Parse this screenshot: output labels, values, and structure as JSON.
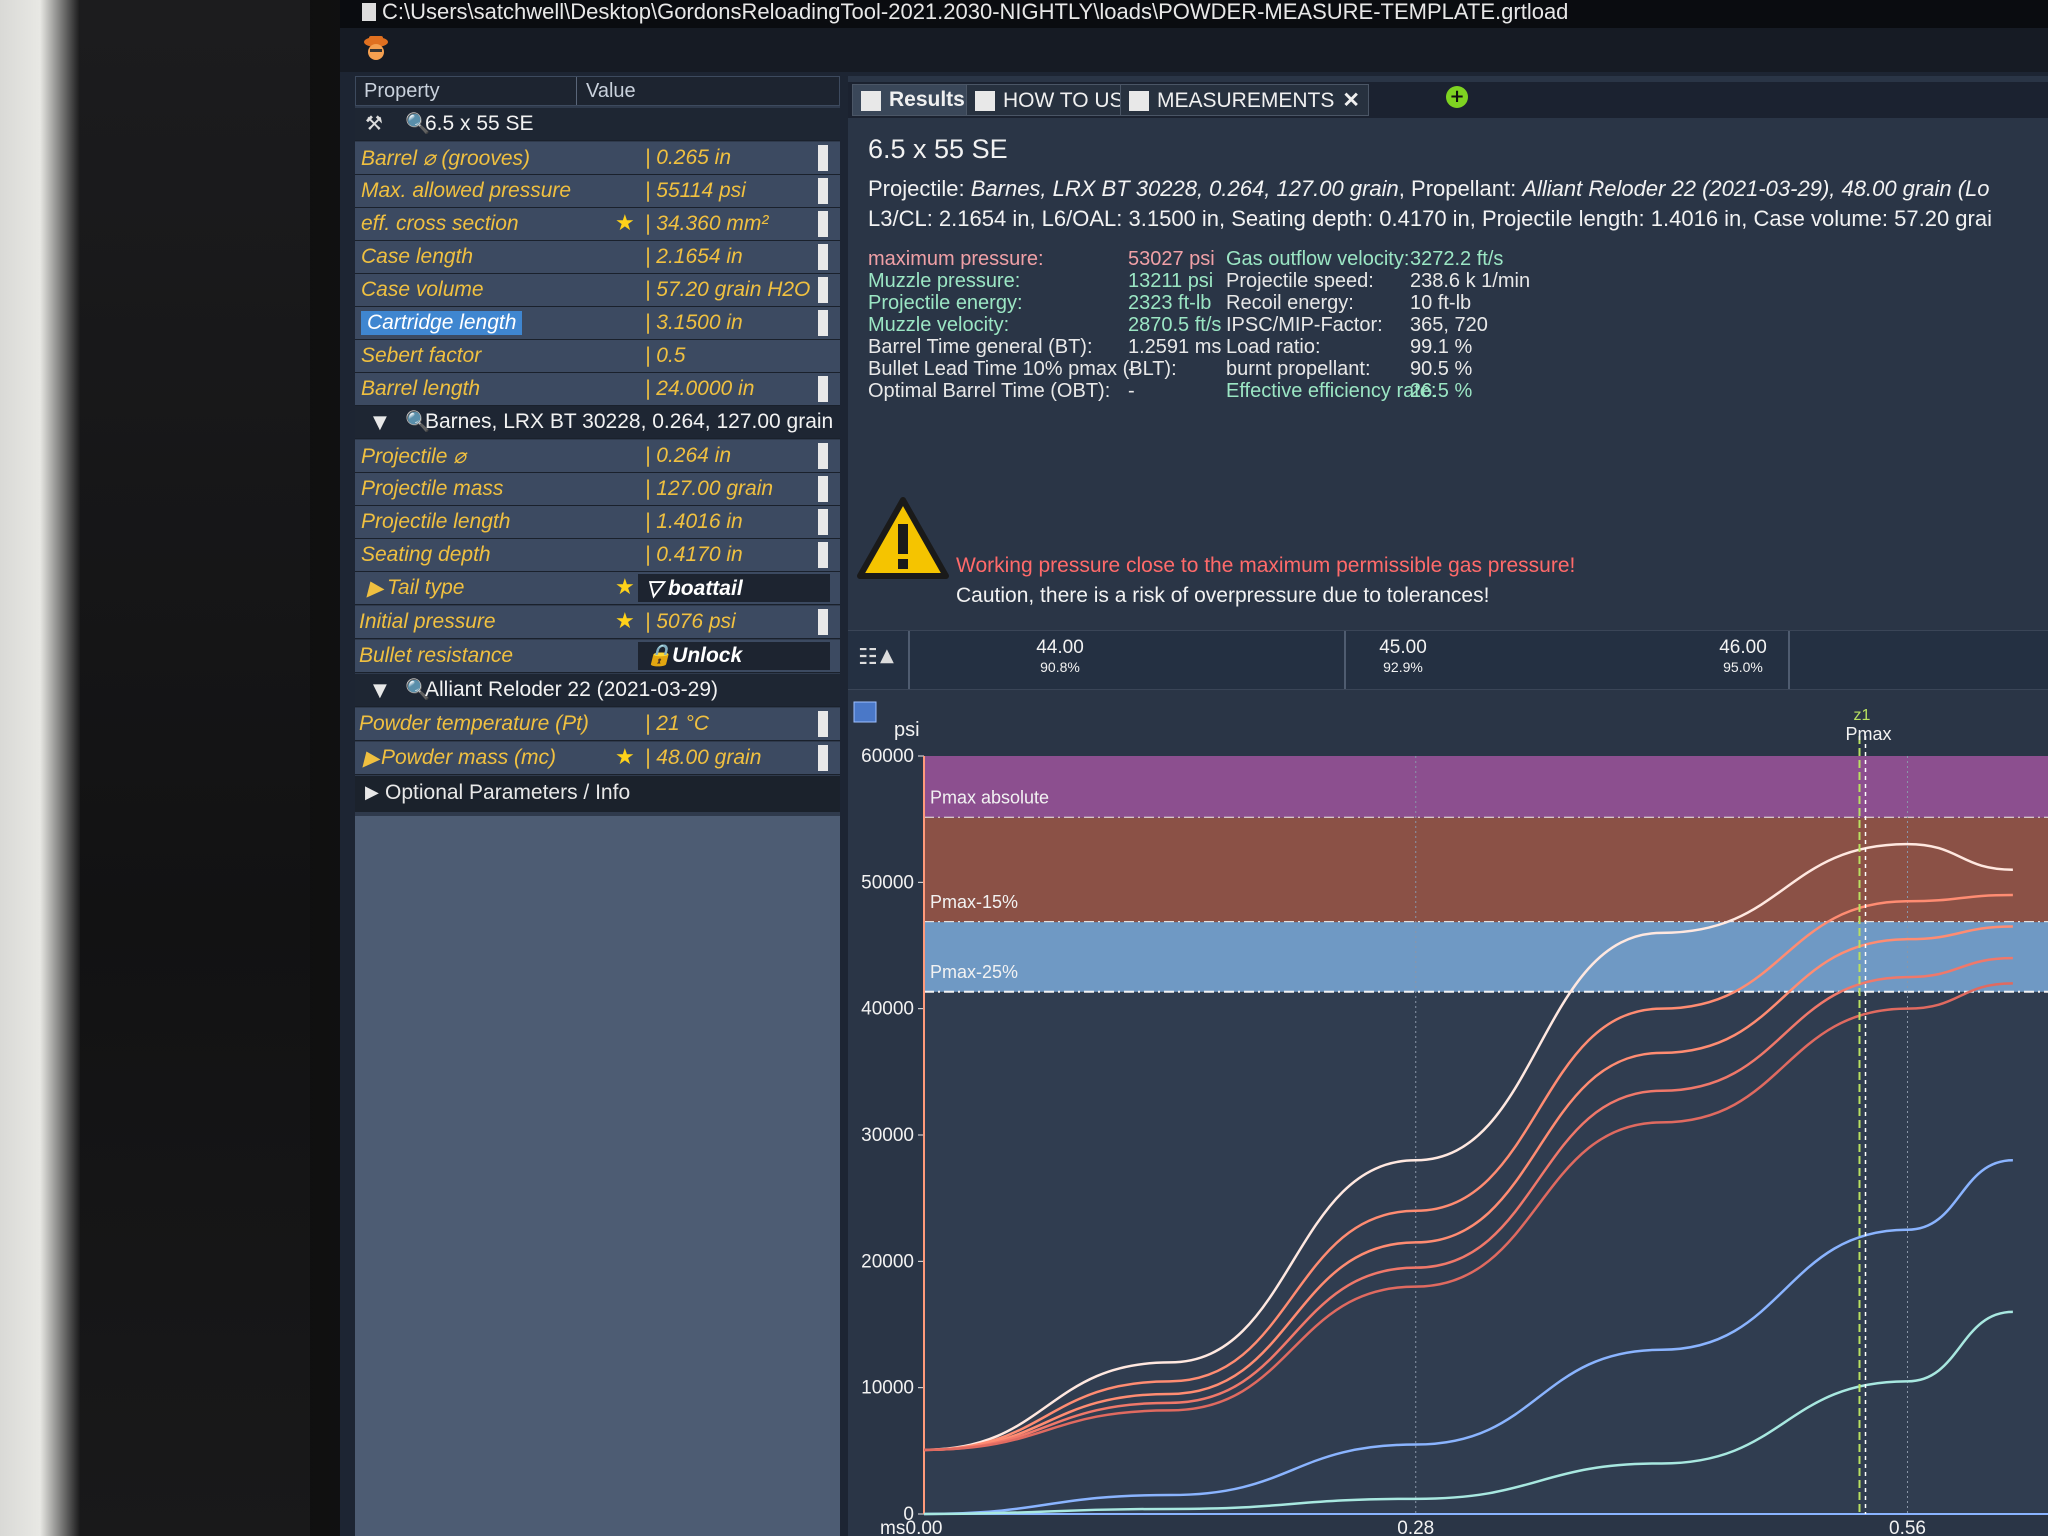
{
  "window": {
    "title": "C:\\Users\\satchwell\\Desktop\\GordonsReloadingTool-2021.2030-NIGHTLY\\loads\\POWDER-MEASURE-TEMPLATE.grtload"
  },
  "property_grid": {
    "header_property": "Property",
    "header_value": "Value",
    "cartridge_group": "6.5 x 55 SE",
    "rows_cartridge": [
      {
        "label": "Barrel ⌀ (grooves)",
        "value": "| 0.265 in",
        "star": false,
        "spin": true
      },
      {
        "label": "Max. allowed pressure",
        "value": "| 55114 psi",
        "star": false,
        "spin": true
      },
      {
        "label": "eff. cross section",
        "value": "| 34.360 mm²",
        "star": true,
        "spin": true
      },
      {
        "label": "Case length",
        "value": "| 2.1654 in",
        "star": false,
        "spin": true
      },
      {
        "label": "Case volume",
        "value": "| 57.20 grain H2O",
        "star": false,
        "spin": true
      },
      {
        "label": "Cartridge length",
        "value": "| 3.1500 in",
        "star": false,
        "spin": true,
        "selected": true
      },
      {
        "label": "Sebert factor",
        "value": "| 0.5",
        "star": false,
        "spin": false
      },
      {
        "label": "Barrel length",
        "value": "| 24.0000 in",
        "star": false,
        "spin": true
      }
    ],
    "projectile_group": "Barnes, LRX BT 30228, 0.264, 127.00 grain",
    "rows_projectile": [
      {
        "label": "Projectile ⌀",
        "value": "| 0.264 in",
        "star": false,
        "spin": true
      },
      {
        "label": "Projectile mass",
        "value": "| 127.00 grain",
        "star": false,
        "spin": true
      },
      {
        "label": "Projectile length",
        "value": "| 1.4016 in",
        "star": false,
        "spin": true
      },
      {
        "label": "Seating depth",
        "value": "| 0.4170 in",
        "star": false,
        "spin": true
      }
    ],
    "tail_type_label": "Tail type",
    "tail_type_value": "boattail",
    "initial_pressure_label": "Initial pressure",
    "initial_pressure_value": "| 5076 psi",
    "bullet_resistance_label": "Bullet resistance",
    "bullet_resistance_value": "Unlock",
    "propellant_group": "Alliant Reloder 22 (2021-03-29)",
    "powder_temp_label": "Powder temperature (Pt)",
    "powder_temp_value": "| 21 °C",
    "powder_mass_label": "Powder mass (mc)",
    "powder_mass_value": "| 48.00 grain",
    "optional_label": "Optional Parameters / Info"
  },
  "tabs": [
    {
      "label": "Results",
      "closable": false,
      "active": true
    },
    {
      "label": "HOW TO USE",
      "closable": true,
      "active": false
    },
    {
      "label": "MEASUREMENTS",
      "closable": true,
      "active": false
    }
  ],
  "results": {
    "title": "6.5 x 55 SE",
    "line1_prefix": "Projectile: ",
    "line1_proj": "Barnes, LRX BT 30228, 0.264, 127.00 grain",
    "line1_mid": ", Propellant: ",
    "line1_prop": "Alliant Reloder 22 (2021-03-29), 48.00 grain (Lo",
    "line2": "L3/CL: 2.1654 in, L6/OAL: 3.1500 in, Seating depth: 0.4170 in, Projectile length: 1.4016 in, Case volume: 57.20 grai",
    "left_col": [
      {
        "label": "maximum pressure:",
        "value": "53027 psi",
        "tone": "pink"
      },
      {
        "label": "Muzzle pressure:",
        "value": "13211 psi",
        "tone": "green"
      },
      {
        "label": "Projectile energy:",
        "value": "2323 ft-lb",
        "tone": "green"
      },
      {
        "label": "Muzzle velocity:",
        "value": "2870.5 ft/s",
        "tone": "green"
      },
      {
        "label": "Barrel Time general (BT):",
        "value": "1.2591 ms",
        "tone": "plain"
      },
      {
        "label": "Bullet Lead Time 10% pmax (BLT):",
        "value": "-",
        "tone": "plain"
      },
      {
        "label": "Optimal Barrel Time (OBT):",
        "value": "-",
        "tone": "plain"
      }
    ],
    "right_col": [
      {
        "label": "Gas outflow velocity:",
        "value": "3272.2 ft/s",
        "tone": "green"
      },
      {
        "label": "Projectile speed:",
        "value": "238.6 k 1/min",
        "tone": "plain"
      },
      {
        "label": "Recoil energy:",
        "value": "10 ft-lb",
        "tone": "plain"
      },
      {
        "label": "IPSC/MIP-Factor:",
        "value": "365, 720",
        "tone": "plain"
      },
      {
        "label": "Load ratio:",
        "value": "99.1 %",
        "tone": "plain"
      },
      {
        "label": "burnt propellant:",
        "value": "90.5 %",
        "tone": "plain"
      },
      {
        "label": "Effective efficiency rate:",
        "value": "26.5 %",
        "tone": "green"
      }
    ],
    "warning_main": "Working pressure close to the maximum permissible gas pressure!",
    "warning_sub": "Caution, there is a risk of overpressure due to tolerances!"
  },
  "ruler": {
    "ticks": [
      {
        "main": "44.00",
        "sub": "90.8%"
      },
      {
        "main": "45.00",
        "sub": "92.9%"
      },
      {
        "main": "46.00",
        "sub": "95.0%"
      }
    ]
  },
  "chart_data": {
    "type": "line",
    "ylabel": "psi",
    "xlabel": "ms",
    "ylim": [
      0,
      60000
    ],
    "yticks": [
      "60000",
      "50000",
      "40000",
      "30000",
      "20000",
      "10000",
      "0"
    ],
    "xticks": [
      "0.00",
      "0.28",
      "0.56"
    ],
    "marker_label": "z1",
    "marker_text": "Pmax",
    "marker_x": 0.56,
    "bands": [
      {
        "label": "Pmax absolute",
        "from": 55114,
        "to": 60000,
        "color": "#8c4f8f"
      },
      {
        "label": "Pmax-15%",
        "from": 46847,
        "to": 55114,
        "color": "#8b5146"
      },
      {
        "label": "Pmax-25%",
        "from": 41336,
        "to": 46847,
        "color": "#6f99c4"
      }
    ],
    "series": [
      {
        "values": [
          [
            0.0,
            5076
          ],
          [
            0.14,
            12000
          ],
          [
            0.28,
            28000
          ],
          [
            0.42,
            46000
          ],
          [
            0.56,
            53027
          ],
          [
            0.62,
            51000
          ]
        ],
        "color": "#ffe8e0"
      },
      {
        "values": [
          [
            0.0,
            5076
          ],
          [
            0.14,
            10500
          ],
          [
            0.28,
            24000
          ],
          [
            0.42,
            40000
          ],
          [
            0.56,
            48500
          ],
          [
            0.62,
            49000
          ]
        ],
        "color": "#ff8c72"
      },
      {
        "values": [
          [
            0.0,
            5076
          ],
          [
            0.14,
            9500
          ],
          [
            0.28,
            21500
          ],
          [
            0.42,
            36500
          ],
          [
            0.56,
            45500
          ],
          [
            0.62,
            46500
          ]
        ],
        "color": "#ff8c72"
      },
      {
        "values": [
          [
            0.0,
            5076
          ],
          [
            0.14,
            8800
          ],
          [
            0.28,
            19500
          ],
          [
            0.42,
            33500
          ],
          [
            0.56,
            42500
          ],
          [
            0.62,
            44000
          ]
        ],
        "color": "#f0786a"
      },
      {
        "values": [
          [
            0.0,
            5076
          ],
          [
            0.14,
            8200
          ],
          [
            0.28,
            18000
          ],
          [
            0.42,
            31000
          ],
          [
            0.56,
            40000
          ],
          [
            0.62,
            42000
          ]
        ],
        "color": "#e06a60"
      },
      {
        "values": [
          [
            0.0,
            0
          ],
          [
            0.14,
            1500
          ],
          [
            0.28,
            5500
          ],
          [
            0.42,
            13000
          ],
          [
            0.56,
            22500
          ],
          [
            0.62,
            28000
          ]
        ],
        "color": "#8ab4ff"
      },
      {
        "values": [
          [
            0.0,
            0
          ],
          [
            0.14,
            400
          ],
          [
            0.28,
            1200
          ],
          [
            0.42,
            4000
          ],
          [
            0.56,
            10500
          ],
          [
            0.62,
            16000
          ]
        ],
        "color": "#a8e8e0"
      }
    ]
  }
}
